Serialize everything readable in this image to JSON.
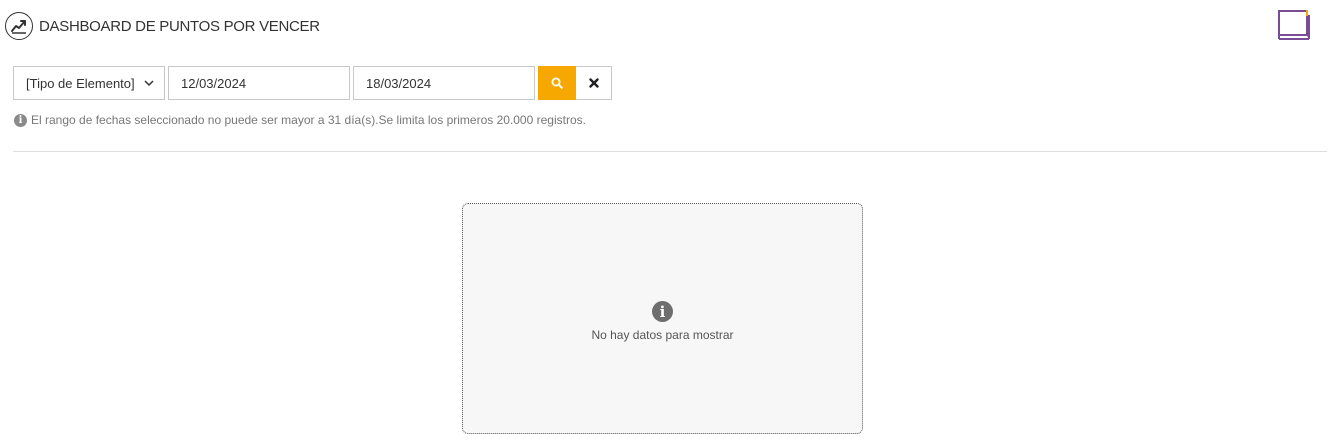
{
  "header": {
    "title": "DASHBOARD DE PUNTOS POR VENCER",
    "title_icon": "trending-chart-icon",
    "right_icon": "book-icon"
  },
  "filters": {
    "element_type": "[Tipo de Elemento]",
    "date_from": "12/03/2024",
    "date_to": "18/03/2024",
    "search_icon": "search-icon",
    "clear_icon": "close-icon"
  },
  "hint": {
    "text": "El rango de fechas seleccionado no puede ser mayor a 31 día(s).Se limita los primeros 20.000 registros.",
    "icon": "info-icon"
  },
  "empty_state": {
    "message": "No hay datos para mostrar",
    "icon": "info-icon"
  },
  "colors": {
    "accent": "#f7a800",
    "book_icon": "#7a4b96",
    "book_spark": "#f7a800"
  }
}
